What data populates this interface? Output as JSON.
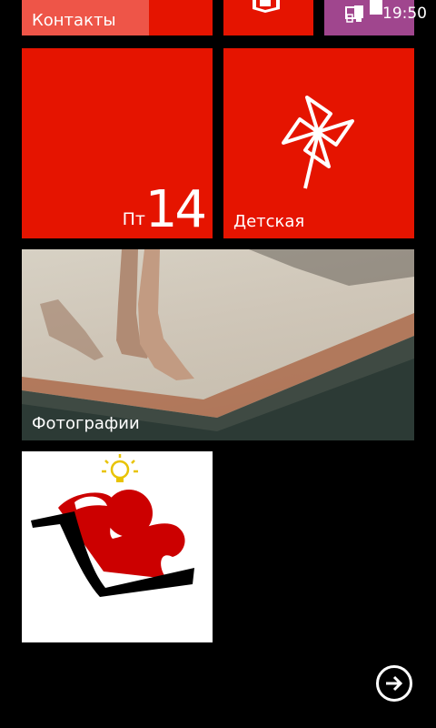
{
  "status_bar": {
    "time": "19:50",
    "signal_icon": "signal-icon"
  },
  "tiles": {
    "contacts": {
      "label": "Контакты",
      "color": "#e51400"
    },
    "office": {
      "icon": "office-icon",
      "color": "#e51400"
    },
    "store": {
      "icon": "store-icon",
      "color": "#a0468e"
    },
    "calendar": {
      "day": "Пт",
      "date": "14",
      "color": "#e51400"
    },
    "kids_corner": {
      "label": "Детская",
      "icon": "pinwheel-icon",
      "color": "#e51400"
    },
    "photos": {
      "label": "Фотографии"
    },
    "app": {
      "icon": "app-logo-icon"
    }
  },
  "nav": {
    "more_icon": "arrow-right-circle-icon"
  }
}
